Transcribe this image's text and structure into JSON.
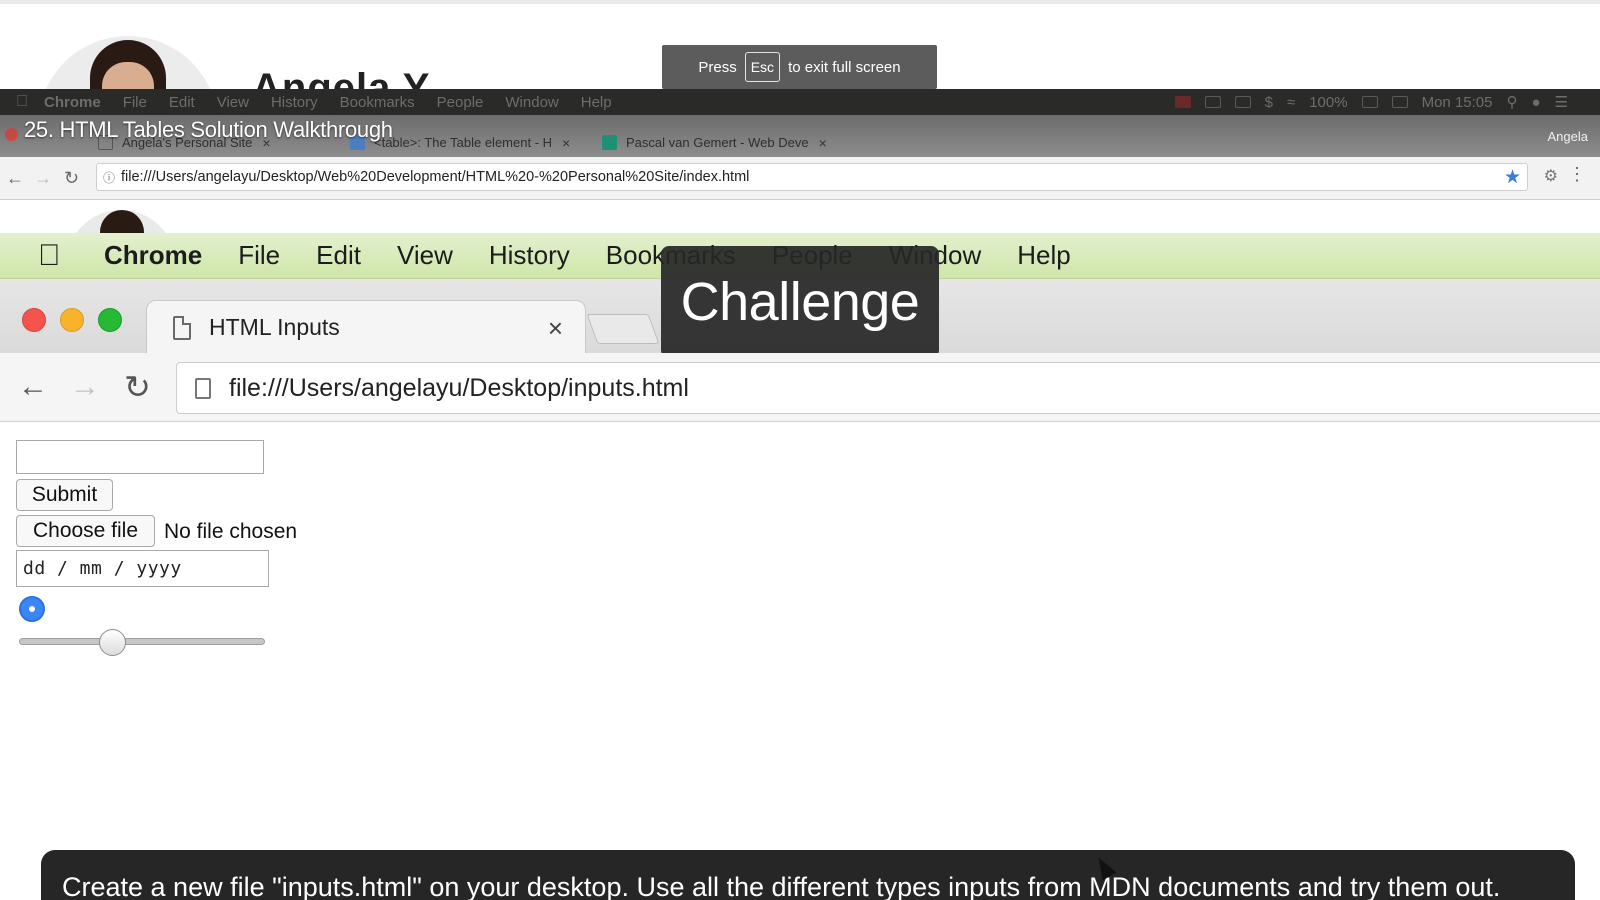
{
  "background_page": {
    "name_partial": "Angela Y"
  },
  "fullscreen_toast": {
    "prefix": "Press",
    "key": "Esc",
    "suffix": "to exit full screen"
  },
  "outer_menubar": {
    "app": "Chrome",
    "items": [
      "File",
      "Edit",
      "View",
      "History",
      "Bookmarks",
      "People",
      "Window",
      "Help"
    ],
    "status": {
      "battery": "100%",
      "clock": "Mon 15:05"
    }
  },
  "video_title": "25. HTML Tables Solution Walkthrough",
  "outer_tabs": [
    {
      "title": "Angela's Personal Site"
    },
    {
      "title": "<table>: The Table element - H"
    },
    {
      "title": "Pascal van Gemert - Web Deve"
    }
  ],
  "outer_profile": "Angela",
  "outer_url": "file:///Users/angelayu/Desktop/Web%20Development/HTML%20-%20Personal%20Site/index.html",
  "inner_menubar": {
    "app": "Chrome",
    "items": [
      "File",
      "Edit",
      "View",
      "History",
      "Bookmarks",
      "People",
      "Window",
      "Help"
    ]
  },
  "inner_tab": {
    "title": "HTML Inputs"
  },
  "challenge_label": "Challenge",
  "inner_url": "file:///Users/angelayu/Desktop/inputs.html",
  "form": {
    "text_value": "",
    "submit_label": "Submit",
    "file_button_label": "Choose file",
    "file_status": "No file chosen",
    "date_placeholder": "dd / mm / yyyy",
    "radio_checked": true,
    "range_value": 0.38
  },
  "caption": "Create a new file \"inputs.html\" on your desktop. Use all the different types inputs from MDN documents and try them out.",
  "colors": {
    "inner_menubar_green": "#cfe6a9",
    "radio_blue": "#3b86f5",
    "traffic_red": "#f4544c",
    "traffic_yellow": "#f8b22b",
    "traffic_green": "#26b935"
  }
}
